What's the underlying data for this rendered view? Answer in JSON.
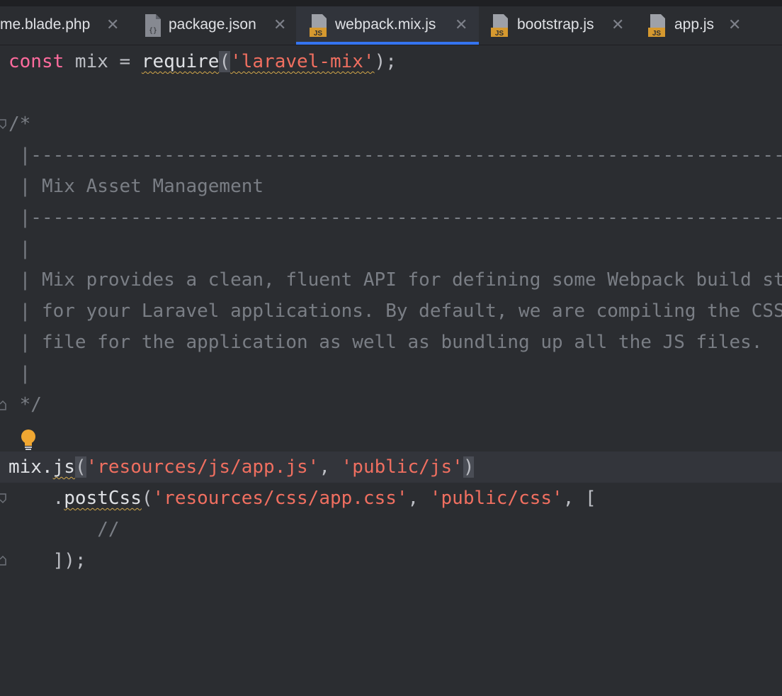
{
  "tabs": [
    {
      "label": "me.blade.php",
      "icon": "php-file-icon",
      "active": false
    },
    {
      "label": "package.json",
      "icon": "json-file-icon",
      "active": false
    },
    {
      "label": "webpack.mix.js",
      "icon": "js-file-icon",
      "active": true
    },
    {
      "label": "bootstrap.js",
      "icon": "js-file-icon",
      "active": false
    },
    {
      "label": "app.js",
      "icon": "js-file-icon",
      "active": false
    }
  ],
  "js_badge": "JS",
  "close_glyph": "✕",
  "code": {
    "l1_kw": "const",
    "l1_mid": " mix = ",
    "l1_fn": "require",
    "l1_open": "(",
    "l1_str": "'laravel-mix'",
    "l1_end": ");",
    "comment_open": "/*",
    "comment_rule_1": " |--------------------------------------------------------------------------",
    "comment_title": " | Mix Asset Management",
    "comment_rule_2": " |--------------------------------------------------------------------------",
    "comment_blank_1": " |",
    "comment_text_1": " | Mix provides a clean, fluent API for defining some Webpack build steps",
    "comment_text_2": " | for your Laravel applications. By default, we are compiling the CSS",
    "comment_text_3": " | file for the application as well as bundling up all the JS files.",
    "comment_blank_2": " |",
    "comment_close": " */",
    "l16_obj": "mix.",
    "l16_fn": "js",
    "l16_open": "(",
    "l16_str1": "'resources/js/app.js'",
    "l16_sep": ", ",
    "l16_str2": "'public/js'",
    "l16_close": ")",
    "l17_indent": "    .",
    "l17_fn": "postCss",
    "l17_open": "(",
    "l17_str1": "'resources/css/app.css'",
    "l17_sep": ", ",
    "l17_str2": "'public/css'",
    "l17_end": ", [",
    "l18_indent": "        ",
    "l18_cmt": "//",
    "l19": "    ]);"
  }
}
